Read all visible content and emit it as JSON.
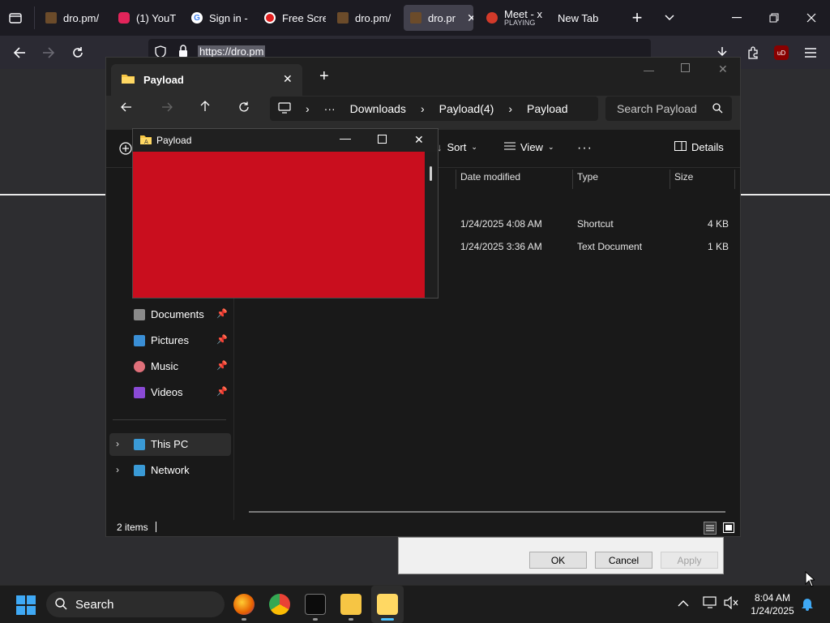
{
  "browser": {
    "tabs": [
      {
        "label": "dro.pm/",
        "favicon_color": "#6b4b2a"
      },
      {
        "label": "(1) YouT",
        "favicon_color": "#e2245a"
      },
      {
        "label": "Sign in -",
        "favicon_color": "#ffffff"
      },
      {
        "label": "Free Scre",
        "favicon_color": "#e22020"
      },
      {
        "label": "dro.pm/",
        "favicon_color": "#6b4b2a"
      },
      {
        "label": "dro.pr",
        "favicon_color": "#6b4b2a",
        "active": true
      },
      {
        "label": "Meet - x",
        "sublabel": "PLAYING",
        "favicon_color": "#d23a2a"
      },
      {
        "label": "New Tab"
      }
    ],
    "url": "https://dro.pm",
    "icons": [
      "tab-list-icon",
      "back-icon",
      "forward-icon",
      "reload-icon",
      "shield-icon",
      "lock-icon",
      "bookmark-star-icon",
      "download-icon",
      "extensions-icon",
      "ublock-icon",
      "menu-icon",
      "new-tab-icon",
      "tab-overflow-icon",
      "minimize-icon",
      "restore-icon",
      "close-icon"
    ],
    "ublock_label": "uD"
  },
  "explorer": {
    "tab_title": "Payload",
    "breadcrumb": [
      "Downloads",
      "Payload(4)",
      "Payload"
    ],
    "breadcrumb_more": "···",
    "search_placeholder": "Search Payload",
    "toolbar": {
      "sort": "Sort",
      "view": "View",
      "more": "···",
      "details": "Details"
    },
    "nav_items": [
      {
        "label": "Documents",
        "pinned": true,
        "color": "#8a8a8a"
      },
      {
        "label": "Pictures",
        "pinned": true,
        "color": "#3a8fd6"
      },
      {
        "label": "Music",
        "pinned": true,
        "color": "#e0707a"
      },
      {
        "label": "Videos",
        "pinned": true,
        "color": "#8a4ad6"
      }
    ],
    "tree_items": [
      {
        "label": "This PC",
        "color": "#3a9ad6"
      },
      {
        "label": "Network",
        "color": "#3a9ad6"
      }
    ],
    "columns": [
      "Date modified",
      "Type",
      "Size"
    ],
    "files": [
      {
        "date": "1/24/2025 4:08 AM",
        "type": "Shortcut",
        "size": "4 KB"
      },
      {
        "date": "1/24/2025 3:36 AM",
        "type": "Text Document",
        "size": "1 KB"
      }
    ],
    "status": "2 items"
  },
  "popup": {
    "title": "Payload",
    "canvas_color": "#c90e1e"
  },
  "dialog": {
    "ok": "OK",
    "cancel": "Cancel",
    "apply": "Apply"
  },
  "taskbar": {
    "search_label": "Search",
    "time": "8:04 AM",
    "date": "1/24/2025"
  }
}
